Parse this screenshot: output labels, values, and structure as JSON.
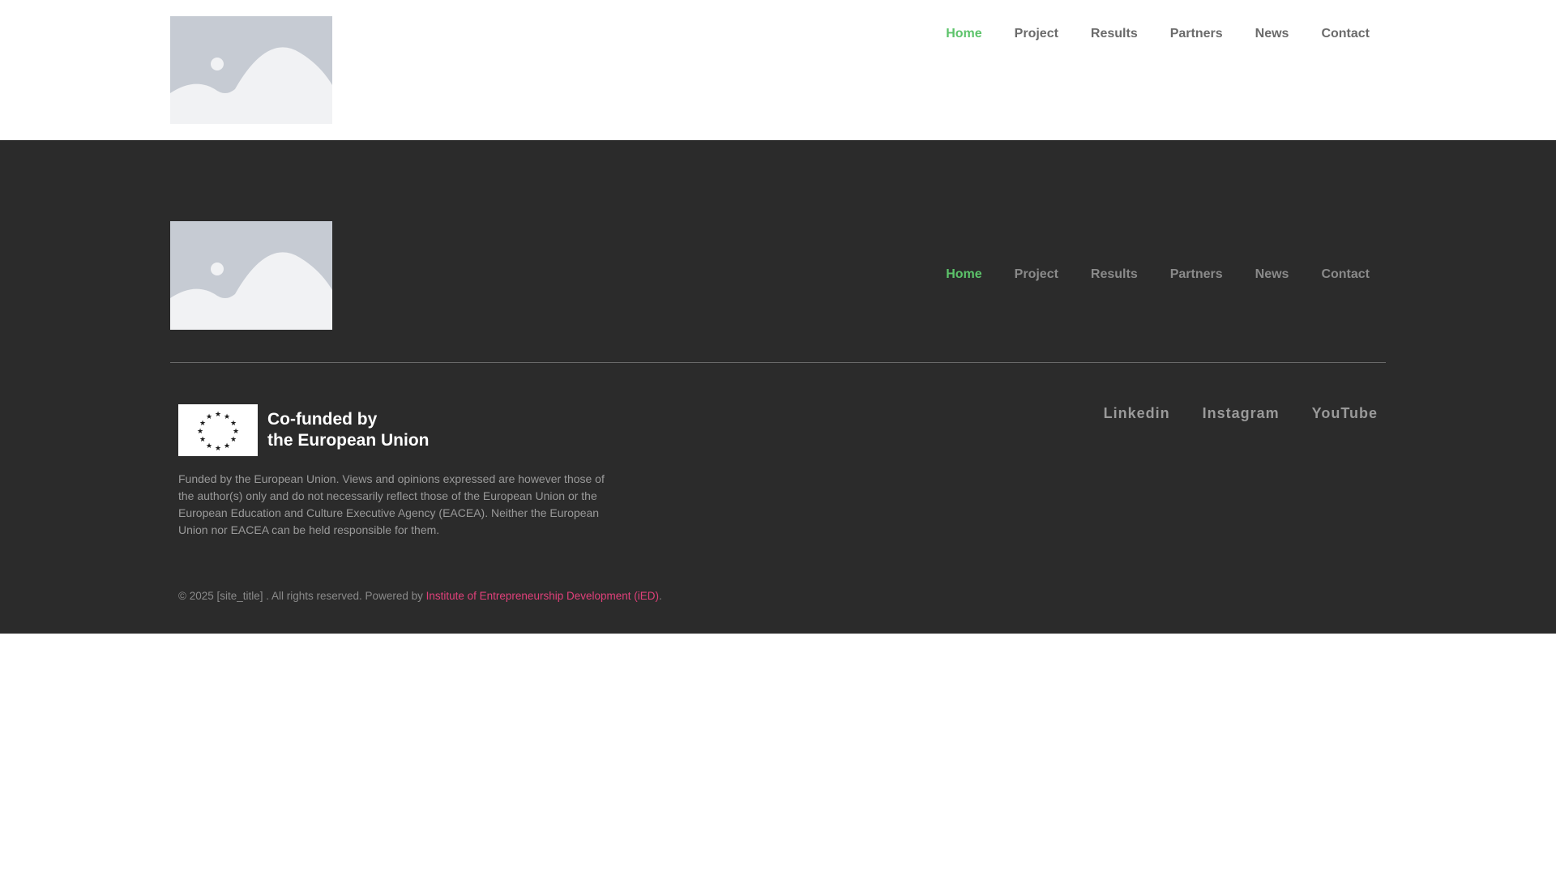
{
  "colors": {
    "nav_active": "#5cc36a",
    "footer_bg": "#2b2b2b",
    "link_accent": "#e0407a"
  },
  "header": {
    "logo": "image-placeholder-icon",
    "nav": [
      {
        "label": "Home",
        "active": true
      },
      {
        "label": "Project",
        "active": false
      },
      {
        "label": "Results",
        "active": false
      },
      {
        "label": "Partners",
        "active": false
      },
      {
        "label": "News",
        "active": false
      },
      {
        "label": "Contact",
        "active": false
      }
    ]
  },
  "footer": {
    "logo": "image-placeholder-icon",
    "nav": [
      {
        "label": "Home",
        "active": true
      },
      {
        "label": "Project",
        "active": false
      },
      {
        "label": "Results",
        "active": false
      },
      {
        "label": "Partners",
        "active": false
      },
      {
        "label": "News",
        "active": false
      },
      {
        "label": "Contact",
        "active": false
      }
    ],
    "eu_badge": {
      "line1": "Co-funded by",
      "line2": "the European Union",
      "icon": "eu-flag-icon"
    },
    "disclaimer": "Funded by the European Union. Views and opinions expressed are however those of the author(s) only and do not necessarily reflect those of the European Union or the European Education and Culture Executive Agency (EACEA). Neither the European Union nor EACEA can be held responsible for them.",
    "social": [
      {
        "label": "Linkedin"
      },
      {
        "label": "Instagram"
      },
      {
        "label": "YouTube"
      }
    ],
    "copyright": {
      "prefix": "© 2025 [site_title] . All rights reserved. Powered by ",
      "link_text": "Institute of Entrepreneurship Development (iED)",
      "suffix": "."
    }
  }
}
